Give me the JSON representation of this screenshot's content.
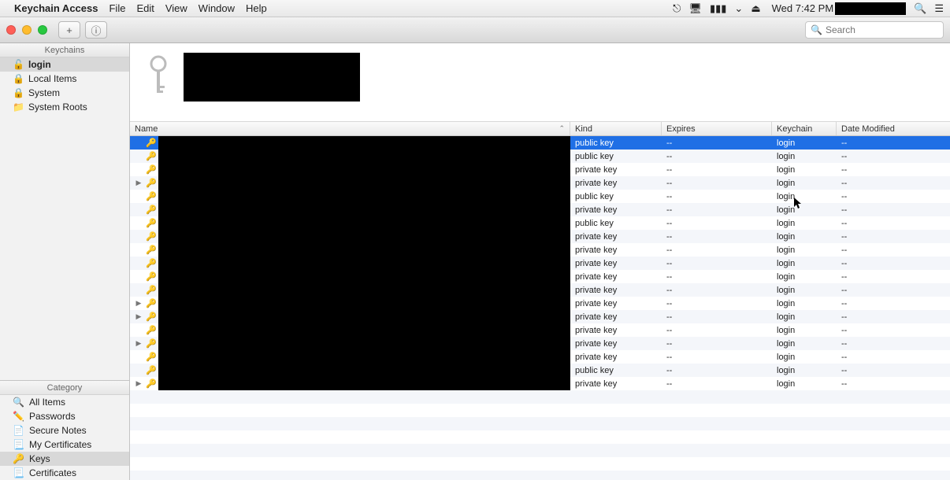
{
  "menubar": {
    "app": "Keychain Access",
    "items": [
      "File",
      "Edit",
      "View",
      "Window",
      "Help"
    ],
    "clock": "Wed 7:42 PM",
    "status_icons": [
      "teamviewer-icon",
      "display-icon",
      "battery-icon",
      "wifi-icon",
      "eject-icon"
    ]
  },
  "toolbar": {
    "add_label": "+",
    "info_label": "ⓘ",
    "search_placeholder": "Search"
  },
  "sidebar": {
    "keychains_header": "Keychains",
    "keychains": [
      {
        "label": "login",
        "icon": "🔓",
        "selected": true
      },
      {
        "label": "Local Items",
        "icon": "🔒",
        "selected": false
      },
      {
        "label": "System",
        "icon": "🔒",
        "selected": false
      },
      {
        "label": "System Roots",
        "icon": "📁",
        "selected": false
      }
    ],
    "category_header": "Category",
    "categories": [
      {
        "label": "All Items",
        "icon": "🔍",
        "selected": false
      },
      {
        "label": "Passwords",
        "icon": "✏️",
        "selected": false
      },
      {
        "label": "Secure Notes",
        "icon": "📄",
        "selected": false
      },
      {
        "label": "My Certificates",
        "icon": "📃",
        "selected": false
      },
      {
        "label": "Keys",
        "icon": "🔑",
        "selected": true
      },
      {
        "label": "Certificates",
        "icon": "📃",
        "selected": false
      }
    ]
  },
  "table": {
    "columns": {
      "name": "Name",
      "kind": "Kind",
      "expires": "Expires",
      "keychain": "Keychain",
      "modified": "Date Modified"
    },
    "sort_col": "name",
    "sort_dir": "asc",
    "rows": [
      {
        "kind": "public key",
        "expires": "--",
        "keychain": "login",
        "modified": "--",
        "selected": true,
        "expandable": false
      },
      {
        "kind": "public key",
        "expires": "--",
        "keychain": "login",
        "modified": "--",
        "selected": false,
        "expandable": false
      },
      {
        "kind": "private key",
        "expires": "--",
        "keychain": "login",
        "modified": "--",
        "selected": false,
        "expandable": false
      },
      {
        "kind": "private key",
        "expires": "--",
        "keychain": "login",
        "modified": "--",
        "selected": false,
        "expandable": true
      },
      {
        "kind": "public key",
        "expires": "--",
        "keychain": "login",
        "modified": "--",
        "selected": false,
        "expandable": false
      },
      {
        "kind": "private key",
        "expires": "--",
        "keychain": "login",
        "modified": "--",
        "selected": false,
        "expandable": false
      },
      {
        "kind": "public key",
        "expires": "--",
        "keychain": "login",
        "modified": "--",
        "selected": false,
        "expandable": false
      },
      {
        "kind": "private key",
        "expires": "--",
        "keychain": "login",
        "modified": "--",
        "selected": false,
        "expandable": false
      },
      {
        "kind": "private key",
        "expires": "--",
        "keychain": "login",
        "modified": "--",
        "selected": false,
        "expandable": false
      },
      {
        "kind": "private key",
        "expires": "--",
        "keychain": "login",
        "modified": "--",
        "selected": false,
        "expandable": false
      },
      {
        "kind": "private key",
        "expires": "--",
        "keychain": "login",
        "modified": "--",
        "selected": false,
        "expandable": false
      },
      {
        "kind": "private key",
        "expires": "--",
        "keychain": "login",
        "modified": "--",
        "selected": false,
        "expandable": false
      },
      {
        "kind": "private key",
        "expires": "--",
        "keychain": "login",
        "modified": "--",
        "selected": false,
        "expandable": true
      },
      {
        "kind": "private key",
        "expires": "--",
        "keychain": "login",
        "modified": "--",
        "selected": false,
        "expandable": true
      },
      {
        "kind": "private key",
        "expires": "--",
        "keychain": "login",
        "modified": "--",
        "selected": false,
        "expandable": false
      },
      {
        "kind": "private key",
        "expires": "--",
        "keychain": "login",
        "modified": "--",
        "selected": false,
        "expandable": true
      },
      {
        "kind": "private key",
        "expires": "--",
        "keychain": "login",
        "modified": "--",
        "selected": false,
        "expandable": false
      },
      {
        "kind": "public key",
        "expires": "--",
        "keychain": "login",
        "modified": "--",
        "selected": false,
        "expandable": false
      },
      {
        "kind": "private key",
        "expires": "--",
        "keychain": "login",
        "modified": "--",
        "selected": false,
        "expandable": true
      }
    ]
  }
}
